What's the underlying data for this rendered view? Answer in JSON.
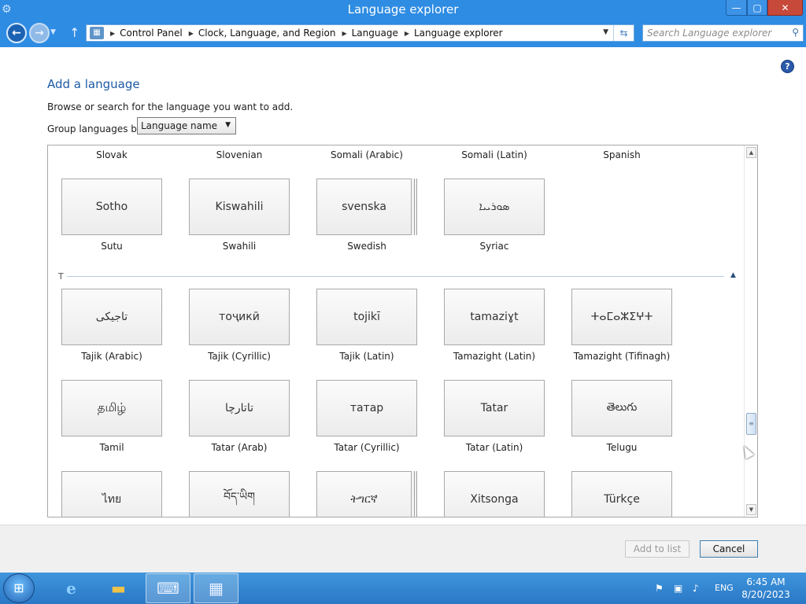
{
  "window": {
    "title": "Language explorer",
    "minimize_glyph": "—",
    "maximize_glyph": "▢",
    "close_glyph": "✕"
  },
  "nav": {
    "breadcrumbs": [
      "Control Panel",
      "Clock, Language, and Region",
      "Language",
      "Language explorer"
    ],
    "search_placeholder": "Search Language explorer"
  },
  "page": {
    "heading": "Add a language",
    "description": "Browse or search for the language you want to add.",
    "group_label": "Group languages by:",
    "group_value": "Language name"
  },
  "languages": {
    "row_top_labels": [
      "Slovak",
      "Slovenian",
      "Somali (Arabic)",
      "Somali (Latin)",
      "Spanish"
    ],
    "row_s": [
      {
        "native": "Sotho",
        "label": "Sutu"
      },
      {
        "native": "Kiswahili",
        "label": "Swahili"
      },
      {
        "native": "svenska",
        "label": "Swedish"
      },
      {
        "native": "ܣܘܪܝܝܐ",
        "label": "Syriac"
      }
    ],
    "section_letter": "T",
    "row_t1": [
      {
        "native": "تاجیکی",
        "label": "Tajik (Arabic)"
      },
      {
        "native": "тоҷикӣ",
        "label": "Tajik (Cyrillic)"
      },
      {
        "native": "tojikī",
        "label": "Tajik (Latin)"
      },
      {
        "native": "tamaziɣt",
        "label": "Tamazight (Latin)"
      },
      {
        "native": "ⵜⴰⵎⴰⵣⵉⵖⵜ",
        "label": "Tamazight (Tifinagh)"
      }
    ],
    "row_t2": [
      {
        "native": "தமிழ்",
        "label": "Tamil"
      },
      {
        "native": "تاتارچا",
        "label": "Tatar (Arab)"
      },
      {
        "native": "татар",
        "label": "Tatar (Cyrillic)"
      },
      {
        "native": "Tatar",
        "label": "Tatar (Latin)"
      },
      {
        "native": "తెలుగు",
        "label": "Telugu"
      }
    ],
    "row_t3": [
      {
        "native": "ไทย"
      },
      {
        "native": "བོད་ཡིག"
      },
      {
        "native": "ትግርኛ"
      },
      {
        "native": "Xitsonga"
      },
      {
        "native": "Türkçe"
      }
    ]
  },
  "footer": {
    "add_label": "Add to list",
    "cancel_label": "Cancel"
  },
  "taskbar": {
    "language": "ENG",
    "time": "6:45 AM",
    "date": "8/20/2023"
  }
}
